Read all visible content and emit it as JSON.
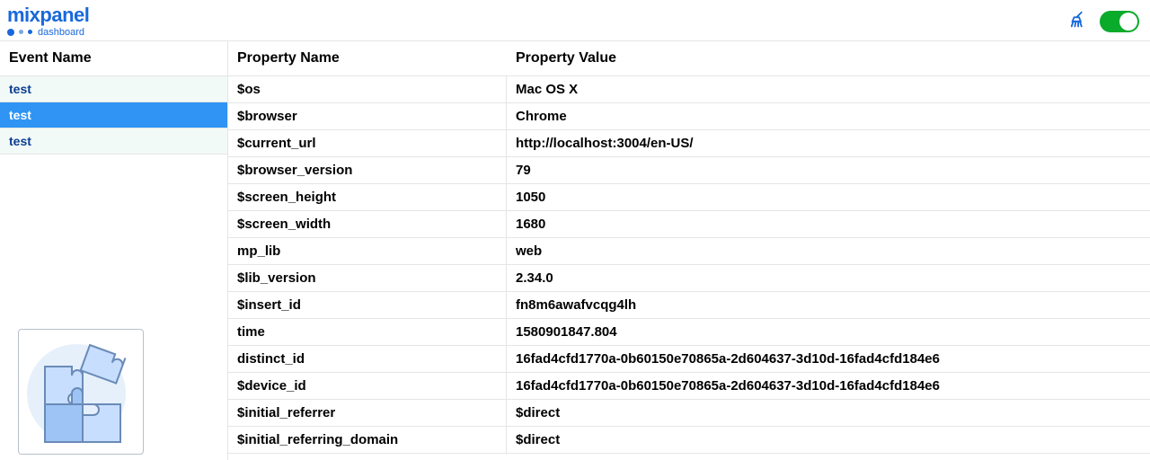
{
  "brand": {
    "name": "mixpanel",
    "sub": "dashboard"
  },
  "columns": {
    "event": "Event Name",
    "prop_name": "Property Name",
    "prop_value": "Property Value"
  },
  "events": [
    {
      "label": "test",
      "selected": false
    },
    {
      "label": "test",
      "selected": true
    },
    {
      "label": "test",
      "selected": false
    }
  ],
  "properties": [
    {
      "name": "$os",
      "value": "Mac OS X"
    },
    {
      "name": "$browser",
      "value": "Chrome"
    },
    {
      "name": "$current_url",
      "value": "http://localhost:3004/en-US/"
    },
    {
      "name": "$browser_version",
      "value": "79"
    },
    {
      "name": "$screen_height",
      "value": "1050"
    },
    {
      "name": "$screen_width",
      "value": "1680"
    },
    {
      "name": "mp_lib",
      "value": "web"
    },
    {
      "name": "$lib_version",
      "value": "2.34.0"
    },
    {
      "name": "$insert_id",
      "value": "fn8m6awafvcqg4lh"
    },
    {
      "name": "time",
      "value": "1580901847.804"
    },
    {
      "name": "distinct_id",
      "value": "16fad4cfd1770a-0b60150e70865a-2d604637-3d10d-16fad4cfd184e6"
    },
    {
      "name": "$device_id",
      "value": "16fad4cfd1770a-0b60150e70865a-2d604637-3d10d-16fad4cfd184e6"
    },
    {
      "name": "$initial_referrer",
      "value": "$direct"
    },
    {
      "name": "$initial_referring_domain",
      "value": "$direct"
    }
  ],
  "toggle_on": true
}
